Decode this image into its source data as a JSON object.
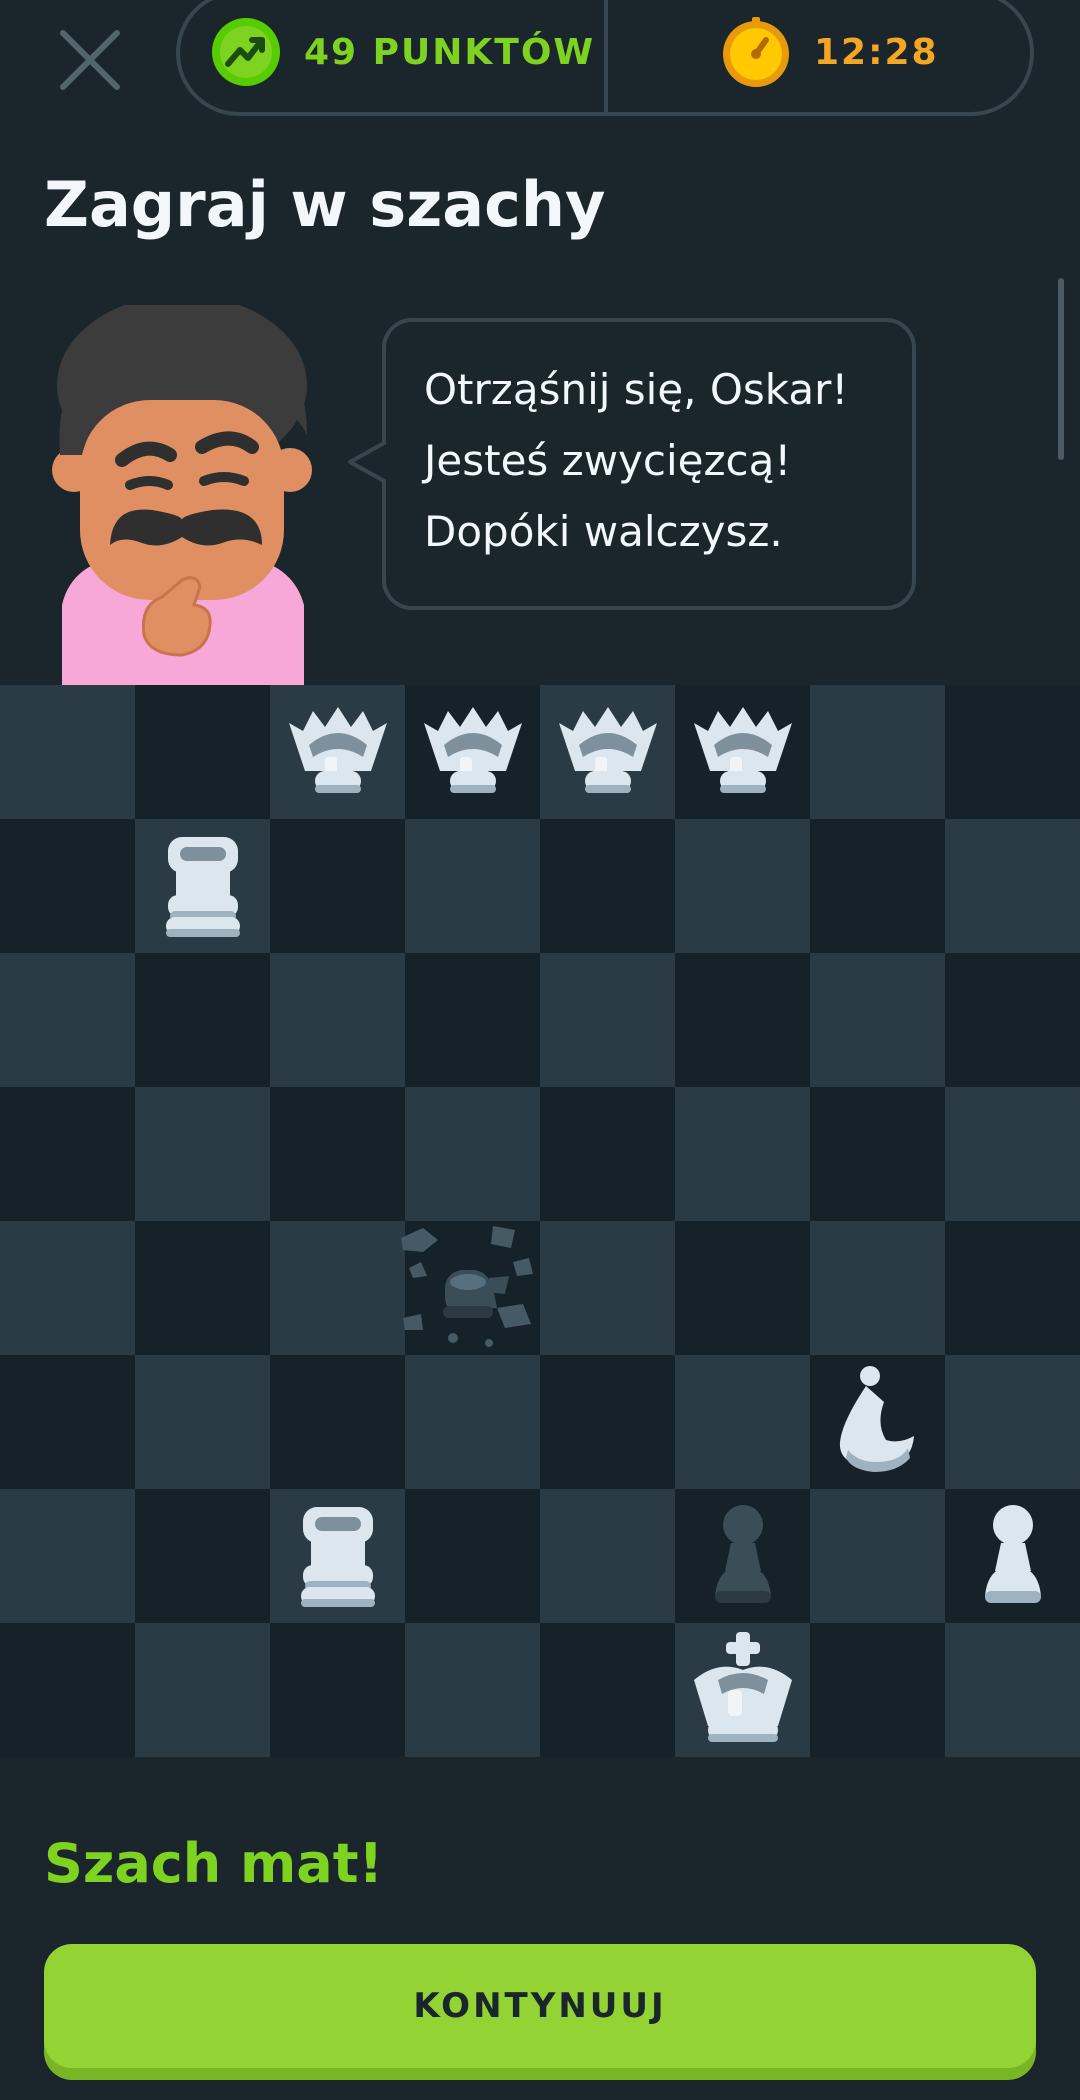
{
  "header": {
    "points_label": "49 PUNKTÓW",
    "timer_label": "12:28",
    "points_color": "#7ed321",
    "timer_color": "#f5a623",
    "close_icon": "close-icon",
    "points_icon": "trend-up-icon",
    "timer_icon": "stopwatch-icon"
  },
  "title": "Zagraj w szachy",
  "speech": {
    "lines": [
      "Otrząśnij się, Oskar!",
      "Jesteś zwycięzcą!",
      "Dopóki walczysz."
    ]
  },
  "board": {
    "size": 8,
    "pieces": [
      {
        "type": "queen",
        "color": "white",
        "square": "c8"
      },
      {
        "type": "queen",
        "color": "white",
        "square": "d8"
      },
      {
        "type": "queen",
        "color": "white",
        "square": "e8"
      },
      {
        "type": "queen",
        "color": "white",
        "square": "f8"
      },
      {
        "type": "rook",
        "color": "white",
        "square": "b7"
      },
      {
        "type": "king",
        "color": "black",
        "square": "d4",
        "state": "shattered"
      },
      {
        "type": "knight",
        "color": "white",
        "square": "g3"
      },
      {
        "type": "rook",
        "color": "white",
        "square": "c2"
      },
      {
        "type": "pawn",
        "color": "black",
        "square": "f2"
      },
      {
        "type": "pawn",
        "color": "white",
        "square": "h2"
      },
      {
        "type": "king",
        "color": "white",
        "square": "f1"
      }
    ]
  },
  "result": "Szach mat!",
  "continue_label": "KONTYNUUJ",
  "accent_color": "#93d333"
}
